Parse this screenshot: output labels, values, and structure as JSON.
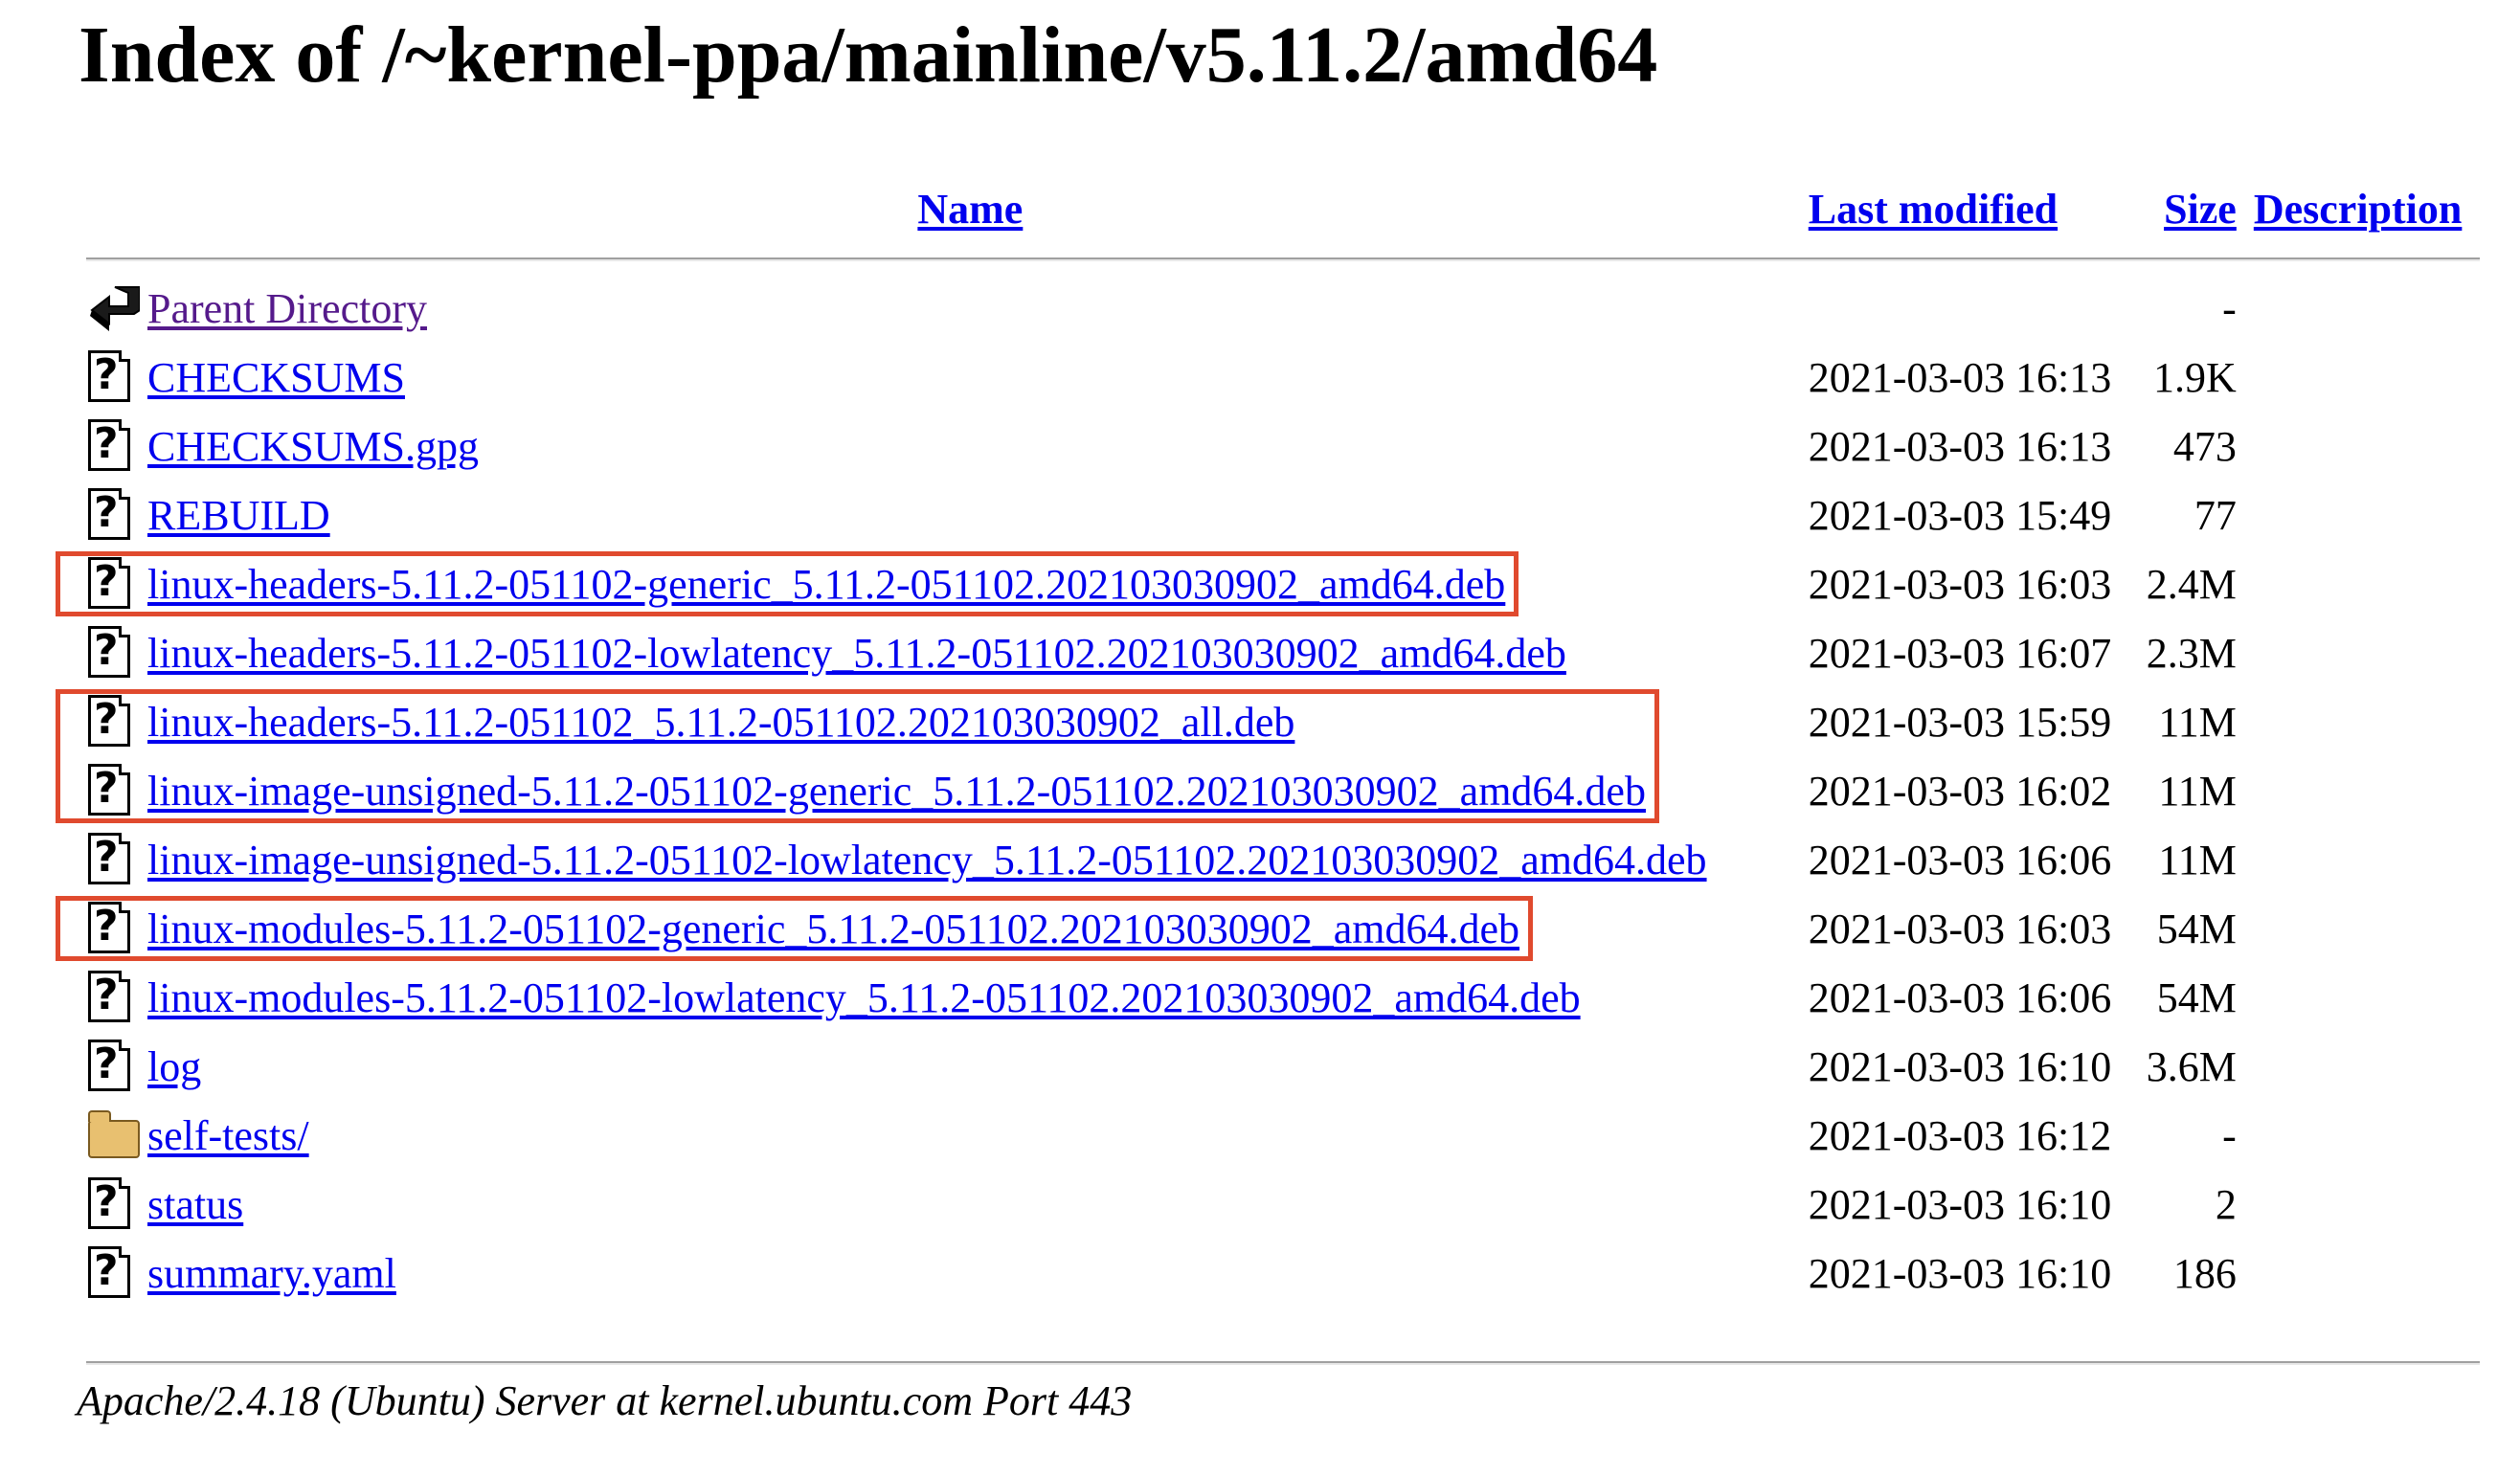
{
  "page": {
    "title": "Index of /~kernel-ppa/mainline/v5.11.2/amd64"
  },
  "columns": {
    "name": "Name",
    "last_modified": "Last modified",
    "size": "Size",
    "description": "Description"
  },
  "parent": {
    "name": "Parent Directory",
    "last_modified": "",
    "size": "-",
    "icon": "back-icon"
  },
  "files": [
    {
      "name": "CHECKSUMS",
      "last_modified": "2021-03-03 16:13",
      "size": "1.9K",
      "icon": "unknown-file-icon",
      "highlighted": false
    },
    {
      "name": "CHECKSUMS.gpg",
      "last_modified": "2021-03-03 16:13",
      "size": "473",
      "icon": "unknown-file-icon",
      "highlighted": false
    },
    {
      "name": "REBUILD",
      "last_modified": "2021-03-03 15:49",
      "size": "77",
      "icon": "unknown-file-icon",
      "highlighted": false
    },
    {
      "name": "linux-headers-5.11.2-051102-generic_5.11.2-051102.202103030902_amd64.deb",
      "last_modified": "2021-03-03 16:03",
      "size": "2.4M",
      "icon": "unknown-file-icon",
      "highlighted": true
    },
    {
      "name": "linux-headers-5.11.2-051102-lowlatency_5.11.2-051102.202103030902_amd64.deb",
      "last_modified": "2021-03-03 16:07",
      "size": "2.3M",
      "icon": "unknown-file-icon",
      "highlighted": false
    },
    {
      "name": "linux-headers-5.11.2-051102_5.11.2-051102.202103030902_all.deb",
      "last_modified": "2021-03-03 15:59",
      "size": "11M",
      "icon": "unknown-file-icon",
      "highlighted": true
    },
    {
      "name": "linux-image-unsigned-5.11.2-051102-generic_5.11.2-051102.202103030902_amd64.deb",
      "last_modified": "2021-03-03 16:02",
      "size": "11M",
      "icon": "unknown-file-icon",
      "highlighted": true
    },
    {
      "name": "linux-image-unsigned-5.11.2-051102-lowlatency_5.11.2-051102.202103030902_amd64.deb",
      "last_modified": "2021-03-03 16:06",
      "size": "11M",
      "icon": "unknown-file-icon",
      "highlighted": false
    },
    {
      "name": "linux-modules-5.11.2-051102-generic_5.11.2-051102.202103030902_amd64.deb",
      "last_modified": "2021-03-03 16:03",
      "size": "54M",
      "icon": "unknown-file-icon",
      "highlighted": true
    },
    {
      "name": "linux-modules-5.11.2-051102-lowlatency_5.11.2-051102.202103030902_amd64.deb",
      "last_modified": "2021-03-03 16:06",
      "size": "54M",
      "icon": "unknown-file-icon",
      "highlighted": false
    },
    {
      "name": "log",
      "last_modified": "2021-03-03 16:10",
      "size": "3.6M",
      "icon": "unknown-file-icon",
      "highlighted": false
    },
    {
      "name": "self-tests/",
      "last_modified": "2021-03-03 16:12",
      "size": "-",
      "icon": "folder-icon",
      "highlighted": false
    },
    {
      "name": "status",
      "last_modified": "2021-03-03 16:10",
      "size": "2",
      "icon": "unknown-file-icon",
      "highlighted": false
    },
    {
      "name": "summary.yaml",
      "last_modified": "2021-03-03 16:10",
      "size": "186",
      "icon": "unknown-file-icon",
      "highlighted": false
    }
  ],
  "colors": {
    "link": "#0000ee",
    "visited_link": "#551a8b",
    "highlight_box": "#e04a2e",
    "folder_fill": "#e8c070"
  },
  "footer": {
    "server_signature": "Apache/2.4.18 (Ubuntu) Server at kernel.ubuntu.com Port 443"
  }
}
